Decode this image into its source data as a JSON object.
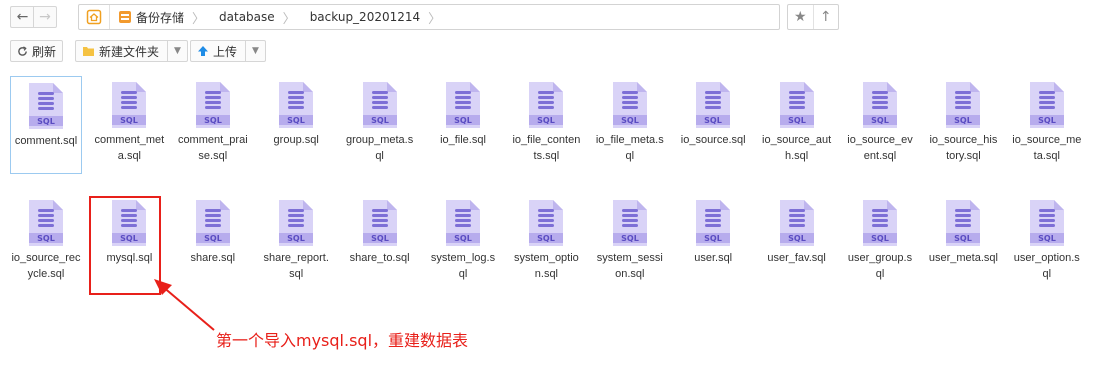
{
  "nav": {
    "back_icon": "←",
    "forward_icon": "→",
    "breadcrumbs": [
      "备份存储",
      "database",
      "backup_20201214"
    ],
    "star_icon": "★",
    "up_icon": "↑"
  },
  "toolbar": {
    "refresh_label": "刷新",
    "new_folder_label": "新建文件夹",
    "upload_label": "上传",
    "caret": "▼"
  },
  "files": [
    "comment.sql",
    "comment_meta.sql",
    "comment_praise.sql",
    "group.sql",
    "group_meta.sql",
    "io_file.sql",
    "io_file_contents.sql",
    "io_file_meta.sql",
    "io_source.sql",
    "io_source_auth.sql",
    "io_source_event.sql",
    "io_source_history.sql",
    "io_source_meta.sql",
    "io_source_recycle.sql",
    "mysql.sql",
    "share.sql",
    "share_report.sql",
    "share_to.sql",
    "system_log.sql",
    "system_option.sql",
    "system_session.sql",
    "user.sql",
    "user_fav.sql",
    "user_group.sql",
    "user_meta.sql",
    "user_option.sql"
  ],
  "icon_label": "SQL",
  "annotation": "第一个导入mysql.sql，重建数据表",
  "colors": {
    "icon_body": "#d9d3f7",
    "icon_fold": "#bfb5ee",
    "icon_lines": "#7d6fd6",
    "icon_band": "#b7aced",
    "accent_red": "#e8201a",
    "folder_yellow": "#f5c242",
    "upload_blue": "#1f8ce6"
  }
}
